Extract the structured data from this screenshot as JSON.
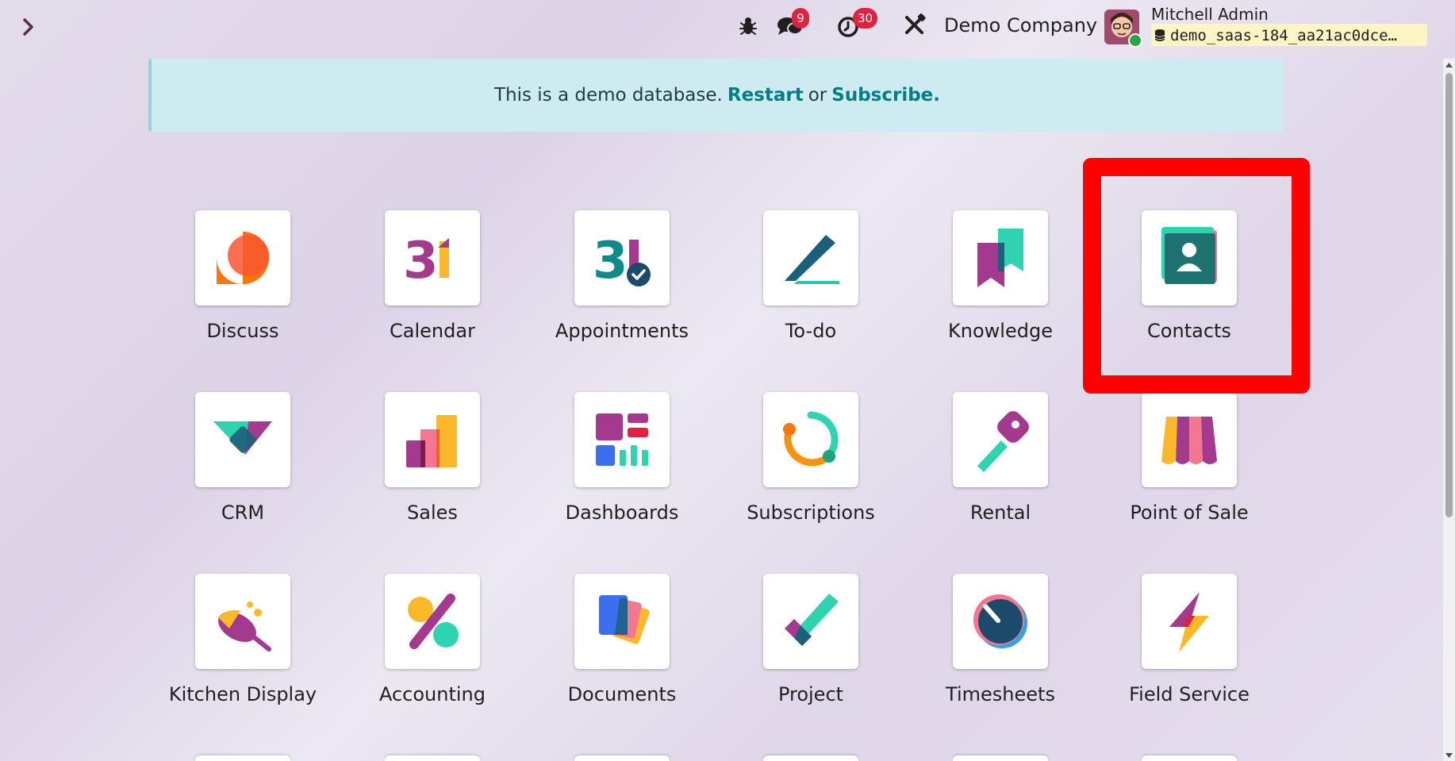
{
  "topbar": {
    "messages_badge": "9",
    "activities_badge": "30",
    "company": "Demo Company",
    "user_name": "Mitchell Admin",
    "database": "demo_saas-184_aa21ac0dce…"
  },
  "banner": {
    "text": "This is a demo database.",
    "restart": "Restart",
    "or": "or",
    "subscribe": "Subscribe."
  },
  "apps": [
    {
      "label": "Discuss",
      "icon": "discuss-icon"
    },
    {
      "label": "Calendar",
      "icon": "calendar-icon"
    },
    {
      "label": "Appointments",
      "icon": "appointments-icon"
    },
    {
      "label": "To-do",
      "icon": "todo-icon"
    },
    {
      "label": "Knowledge",
      "icon": "knowledge-icon"
    },
    {
      "label": "Contacts",
      "icon": "contacts-icon"
    },
    {
      "label": "CRM",
      "icon": "crm-icon"
    },
    {
      "label": "Sales",
      "icon": "sales-icon"
    },
    {
      "label": "Dashboards",
      "icon": "dashboards-icon"
    },
    {
      "label": "Subscriptions",
      "icon": "subscriptions-icon"
    },
    {
      "label": "Rental",
      "icon": "rental-icon"
    },
    {
      "label": "Point of Sale",
      "icon": "point-of-sale-icon"
    },
    {
      "label": "Kitchen Display",
      "icon": "kitchen-display-icon"
    },
    {
      "label": "Accounting",
      "icon": "accounting-icon"
    },
    {
      "label": "Documents",
      "icon": "documents-icon"
    },
    {
      "label": "Project",
      "icon": "project-icon"
    },
    {
      "label": "Timesheets",
      "icon": "timesheets-icon"
    },
    {
      "label": "Field Service",
      "icon": "field-service-icon"
    }
  ],
  "colors": {
    "highlight": "#ff0000",
    "badge": "#e0213f",
    "link": "#017e84",
    "banner_bg": "#cdebf0"
  }
}
